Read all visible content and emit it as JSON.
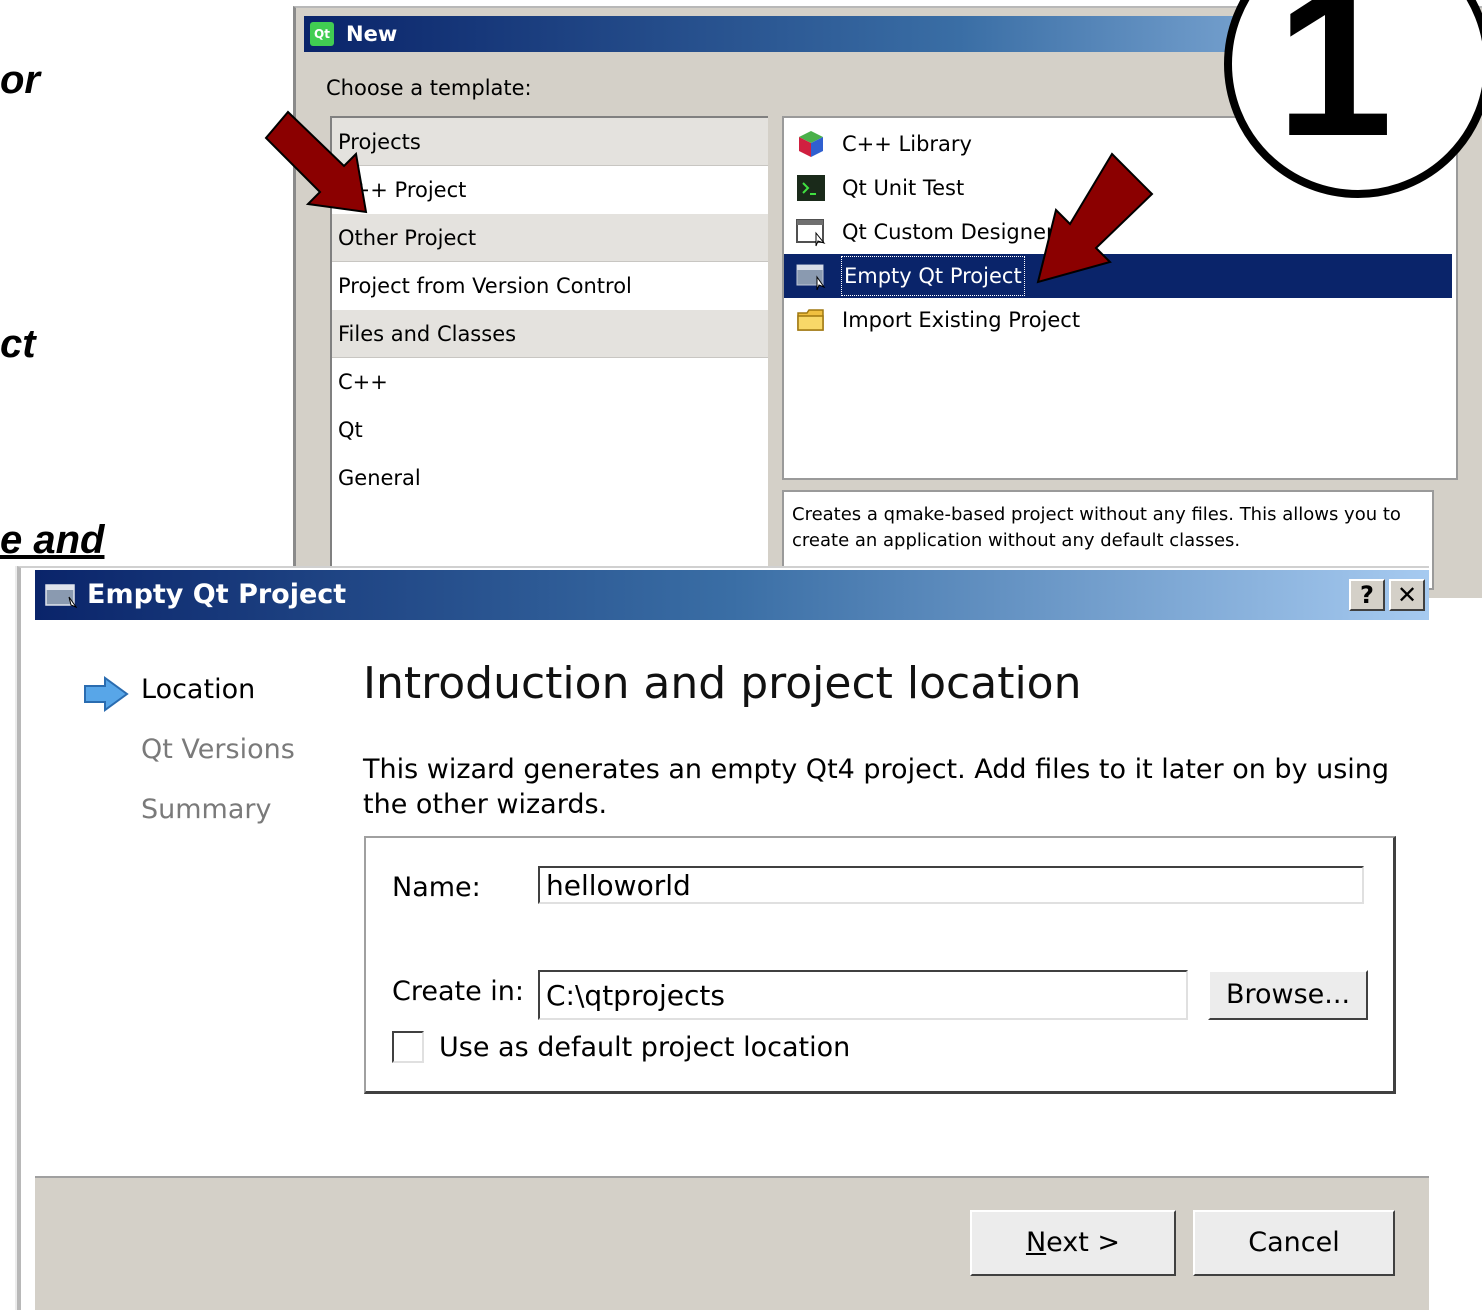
{
  "side_texts": [
    "or",
    "ct",
    "e and"
  ],
  "new_dialog": {
    "title": "New",
    "logo": "Qt",
    "choose_label": "Choose a template:",
    "categories": [
      {
        "label": "Projects",
        "header": true
      },
      {
        "label": "C++ Project",
        "header": false
      },
      {
        "label": "Other Project",
        "header": true
      },
      {
        "label": "Project from Version Control",
        "header": false
      },
      {
        "label": "Files and Classes",
        "header": true
      },
      {
        "label": "C++",
        "header": false
      },
      {
        "label": "Qt",
        "header": false
      },
      {
        "label": "General",
        "header": false
      }
    ],
    "templates": [
      {
        "label": "C++ Library",
        "icon": "cube-icon"
      },
      {
        "label": "Qt Unit Test",
        "icon": "terminal-icon"
      },
      {
        "label": "Qt Custom Designer",
        "icon": "designer-window-icon"
      },
      {
        "label": "Empty Qt Project",
        "icon": "window-icon",
        "selected": true
      },
      {
        "label": "Import Existing Project",
        "icon": "folder-icon"
      }
    ],
    "description": "Creates a qmake-based project without any files. This allows you to create an application without any default classes."
  },
  "step_badge": "1",
  "wizard": {
    "title": "Empty Qt Project",
    "help_button": "?",
    "close_button": "✕",
    "steps": [
      {
        "label": "Location",
        "active": true
      },
      {
        "label": "Qt Versions",
        "active": false
      },
      {
        "label": "Summary",
        "active": false
      }
    ],
    "heading": "Introduction and project location",
    "description": "This wizard generates an empty Qt4 project. Add files to it later on by using the other wizards.",
    "name_label": "Name:",
    "name_value": "helloworld",
    "create_in_label": "Create in:",
    "create_in_value": "C:\\qtprojects",
    "browse_label": "Browse...",
    "default_location_label": "Use as default project location",
    "default_location_checked": false,
    "next_label": "Next >",
    "next_mnemonic": "N",
    "next_rest": "ext >",
    "cancel_label": "Cancel"
  },
  "colors": {
    "annotation_arrow": "#8b0000",
    "selection": "#0a246a",
    "dialog_face": "#d4d0c8"
  }
}
